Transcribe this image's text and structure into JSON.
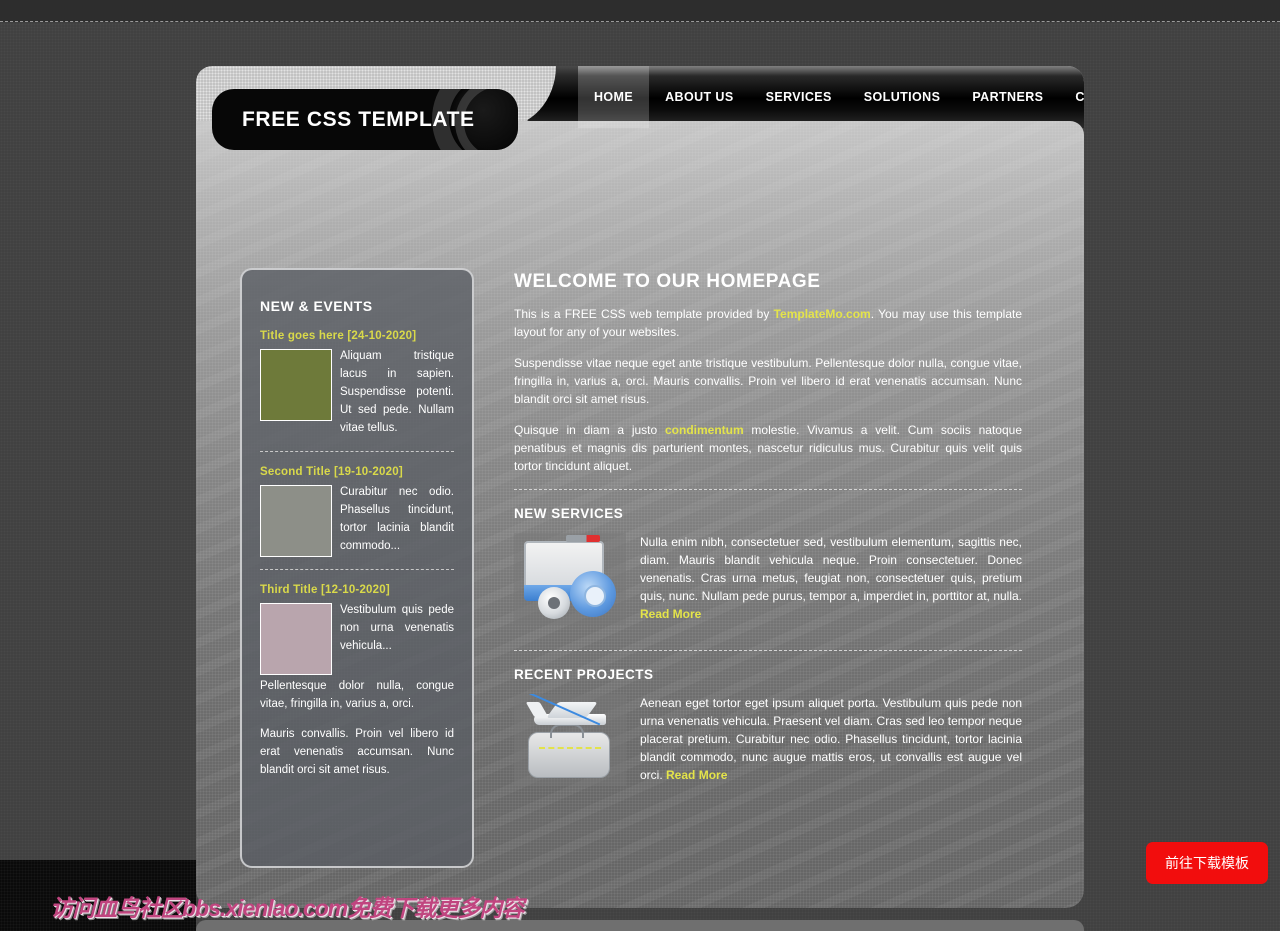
{
  "site": {
    "logo_text": "FREE CSS TEMPLATE"
  },
  "nav": {
    "items": [
      {
        "label": "HOME",
        "active": true
      },
      {
        "label": "ABOUT US",
        "active": false
      },
      {
        "label": "SERVICES",
        "active": false
      },
      {
        "label": "SOLUTIONS",
        "active": false
      },
      {
        "label": "PARTNERS",
        "active": false
      },
      {
        "label": "CONTACT",
        "active": false
      }
    ]
  },
  "sidebar": {
    "heading": "NEW & EVENTS",
    "news": [
      {
        "title": "Title goes here [24-10-2020]",
        "text": "Aliquam tristique lacus in sapien. Suspendisse potenti. Ut sed pede. Nullam vitae tellus.",
        "thumb": "yellow-flower-thumbnail"
      },
      {
        "title": "Second Title [19-10-2020]",
        "text": "Curabitur nec odio. Phasellus tincidunt, tortor lacinia blandit commodo...",
        "thumb": "white-orchid-thumbnail"
      },
      {
        "title": "Third Title [12-10-2020]",
        "text": "Vestibulum quis pede non urna venenatis vehicula...",
        "thumb": "pink-orchid-thumbnail"
      }
    ],
    "extra_paragraphs": [
      "Pellentesque dolor nulla, congue vitae, fringilla in, varius a, orci.",
      "Mauris convallis. Proin vel libero id erat venenatis accumsan. Nunc blandit orci sit amet risus."
    ]
  },
  "main": {
    "heading": "WELCOME TO OUR HOMEPAGE",
    "intro_before_link": "This is a FREE CSS web template provided by ",
    "intro_link": "TemplateMo.com",
    "intro_after_link": ". You may use this template layout for any of your websites.",
    "paragraph2": "Suspendisse vitae neque eget ante tristique vestibulum. Pellentesque dolor nulla, congue vitae, fringilla in, varius a, orci. Mauris convallis. Proin vel libero id erat venenatis accumsan. Nunc blandit orci sit amet risus.",
    "p3_before_link": "Quisque in diam a justo ",
    "p3_link": "condimentum",
    "p3_after_link": " molestie. Vivamus a velit. Cum sociis natoque penatibus et magnis dis parturient montes, nascetur ridiculus mus. Curabitur quis velit quis tortor tincidunt aliquet.",
    "services": {
      "heading": "NEW SERVICES",
      "text": "Nulla enim nibh, consectetuer sed, vestibulum elementum, sagittis nec, diam. Mauris blandit vehicula neque. Proin consectetuer. Donec venenatis. Cras urna metus, feugiat non, consectetuer quis, pretium quis, nunc. Nullam pede purus, tempor a, imperdiet in, porttitor at, nulla. ",
      "read_more": "Read More",
      "image": "window-and-gears-icon"
    },
    "projects": {
      "heading": "RECENT PROJECTS",
      "text": "Aenean eget tortor eget ipsum aliquet porta. Vestibulum quis pede non urna venenatis vehicula. Praesent vel diam. Cras sed leo tempor neque placerat pretium. Curabitur nec odio. Phasellus tincidunt, tortor lacinia blandit commodo, nunc augue mattis eros, ut convallis est augue vel orci. ",
      "read_more": "Read More",
      "image": "airplane-and-luggage-icon"
    }
  },
  "overlay": {
    "watermark": "访问血鸟社区bbs.xienlao.com免费下载更多内容",
    "download_button": "前往下载模板"
  },
  "colors": {
    "accent_yellow": "#e4e44a",
    "news_title_yellow": "#d9d94a",
    "download_red": "#f20d0d",
    "watermark_pink": "#c0457f"
  }
}
